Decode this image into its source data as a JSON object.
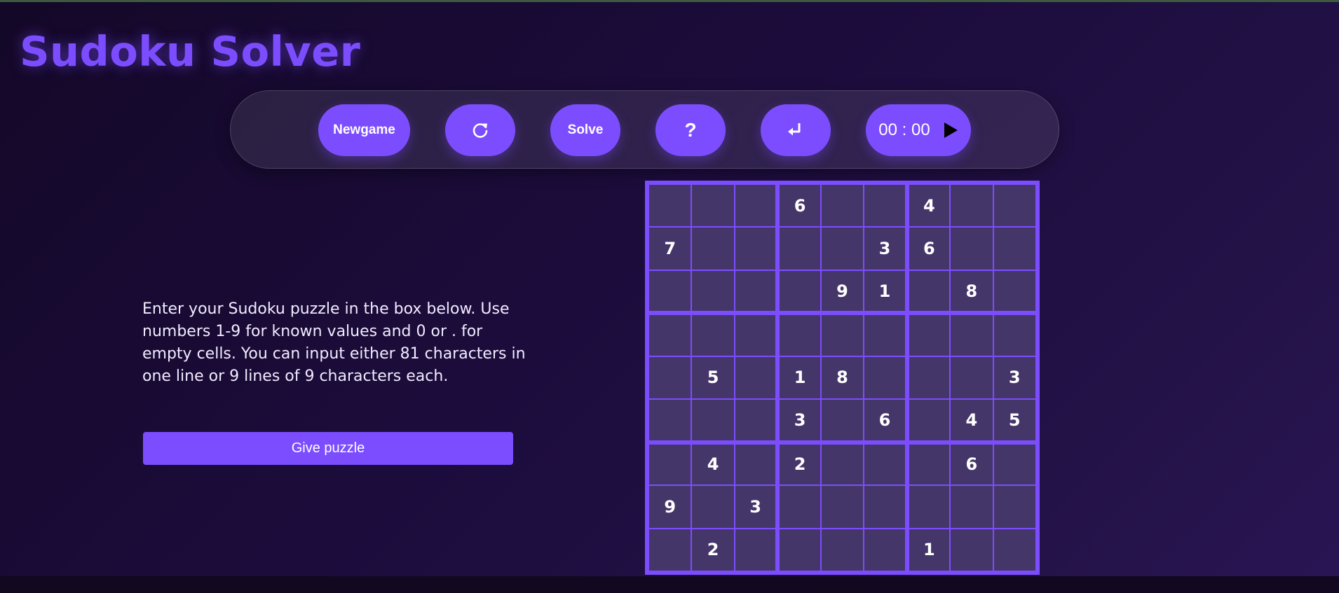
{
  "app": {
    "title": "Sudoku Solver"
  },
  "toolbar": {
    "new_game_label": "Newgame",
    "refresh_icon": "refresh-icon",
    "solve_label": "Solve",
    "hint_label": "?",
    "enter_icon": "enter-return-icon",
    "timer_text": "00 : 00",
    "play_icon": "play-icon"
  },
  "instructions": {
    "text": "Enter your Sudoku puzzle in the box below. Use numbers 1-9 for known values and 0 or . for empty cells. You can input either 81 characters in one line or 9 lines of 9 characters each."
  },
  "give_puzzle": {
    "label": "Give puzzle"
  },
  "board": {
    "rows": [
      [
        "",
        "",
        "",
        "6",
        "",
        "",
        "4",
        "",
        ""
      ],
      [
        "7",
        "",
        "",
        "",
        "",
        "3",
        "6",
        "",
        ""
      ],
      [
        "",
        "",
        "",
        "",
        "9",
        "1",
        "",
        "8",
        ""
      ],
      [
        "",
        "",
        "",
        "",
        "",
        "",
        "",
        "",
        ""
      ],
      [
        "",
        "5",
        "",
        "1",
        "8",
        "",
        "",
        "",
        "3"
      ],
      [
        "",
        "",
        "",
        "3",
        "",
        "6",
        "",
        "4",
        "5"
      ],
      [
        "",
        "4",
        "",
        "2",
        "",
        "",
        "",
        "6",
        ""
      ],
      [
        "9",
        "",
        "3",
        "",
        "",
        "",
        "",
        "",
        ""
      ],
      [
        "",
        "2",
        "",
        "",
        "",
        "",
        "1",
        "",
        ""
      ]
    ]
  },
  "colors": {
    "accent": "#7c4dff",
    "cell_background": "#45366a",
    "page_background": "#1c0c3c",
    "text": "#ffffff"
  }
}
